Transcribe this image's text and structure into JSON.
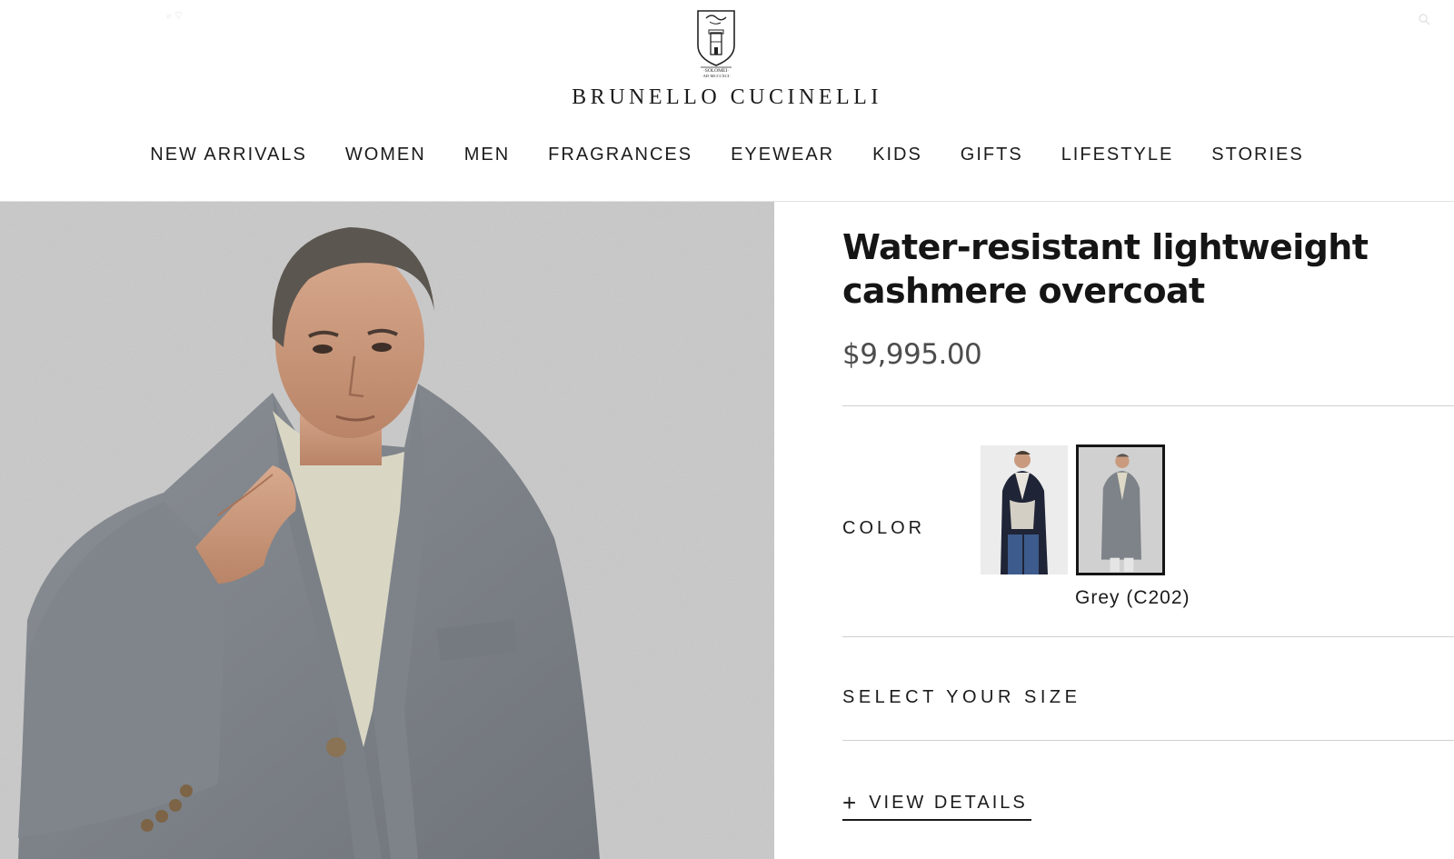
{
  "header": {
    "brand": "BRUNELLO CUCINELLI",
    "logo_icon": "brunello-cucinelli-crest-icon",
    "nav": [
      {
        "label": "NEW ARRIVALS"
      },
      {
        "label": "WOMEN"
      },
      {
        "label": "MEN"
      },
      {
        "label": "FRAGRANCES"
      },
      {
        "label": "EYEWEAR"
      },
      {
        "label": "KIDS"
      },
      {
        "label": "GIFTS"
      },
      {
        "label": "LIFESTYLE"
      },
      {
        "label": "STORIES"
      }
    ]
  },
  "product": {
    "title": "Water-resistant lightweight cashmere overcoat",
    "price": "$9,995.00",
    "color_label": "COLOR",
    "swatches": [
      {
        "icon": "navy-overcoat-thumbnail",
        "selected": false
      },
      {
        "icon": "grey-overcoat-thumbnail",
        "selected": true
      }
    ],
    "selected_color": "Grey (C202)",
    "size_label": "SELECT YOUR SIZE",
    "details_icon": "plus-icon",
    "details_label": "VIEW DETAILS"
  },
  "colors": {
    "text": "#1b1b1b",
    "price": "#4d4d4d",
    "divider": "#d0d0d0",
    "background": "#ffffff"
  }
}
